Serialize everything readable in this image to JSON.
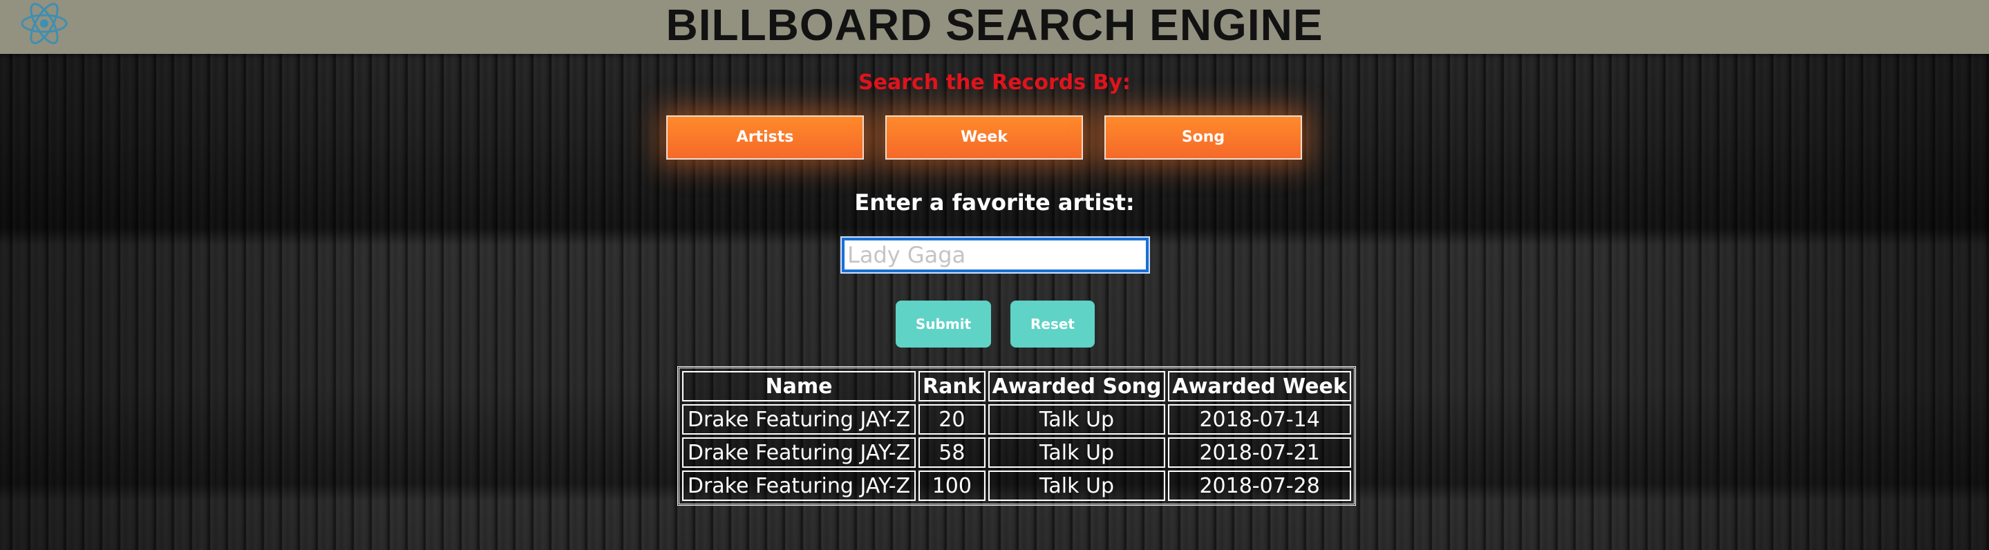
{
  "header": {
    "title": "BILLBOARD SEARCH ENGINE",
    "logo_icon": "react-atom-icon",
    "background_color": "#93917f"
  },
  "search": {
    "label": "Search the Records By:",
    "label_color": "#e0131d",
    "modes": [
      "Artists",
      "Week",
      "Song"
    ],
    "mode_button_color": "#f5692a"
  },
  "form": {
    "prompt": "Enter a favorite artist:",
    "input_value": "",
    "input_placeholder": "Lady Gaga",
    "submit_label": "Submit",
    "reset_label": "Reset",
    "action_button_color": "#5fd3c6"
  },
  "results": {
    "columns": [
      "Name",
      "Rank",
      "Awarded Song",
      "Awarded Week"
    ],
    "rows": [
      [
        "Drake Featuring JAY-Z",
        "20",
        "Talk Up",
        "2018-07-14"
      ],
      [
        "Drake Featuring JAY-Z",
        "58",
        "Talk Up",
        "2018-07-21"
      ],
      [
        "Drake Featuring JAY-Z",
        "100",
        "Talk Up",
        "2018-07-28"
      ]
    ]
  }
}
